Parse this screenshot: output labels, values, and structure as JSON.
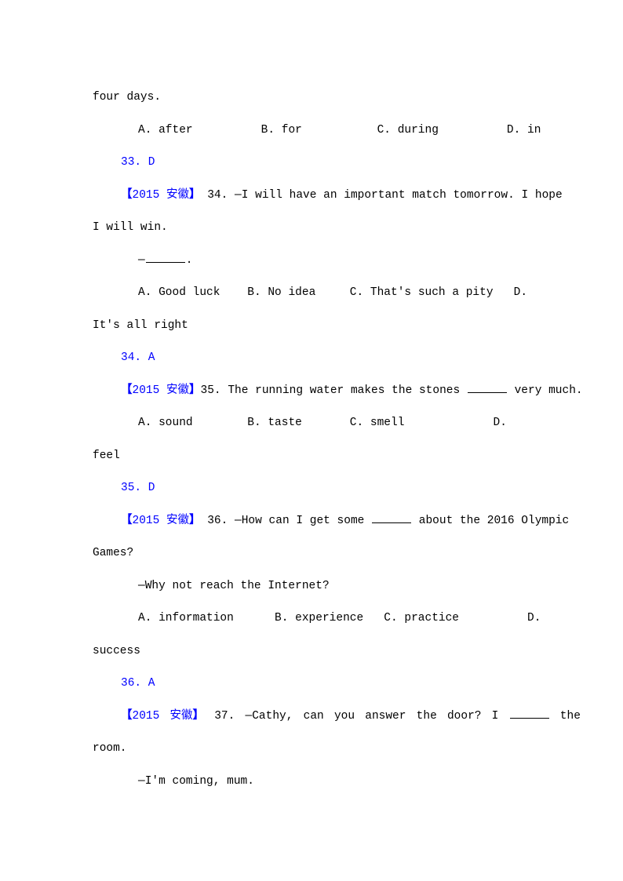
{
  "document": {
    "type": "exam-worksheet",
    "language": "en-zh",
    "colors": {
      "text": "#000000",
      "answer": "#0000ff",
      "source_tag": "#0000ff",
      "background": "#ffffff"
    },
    "source_tag_label": "【2015 安徽】",
    "blank_marker": "______",
    "dash_marker": "—"
  },
  "lines": [
    {
      "id": "q33-stem-cont",
      "kind": "stem-continuation",
      "indent": 0,
      "text": "four days."
    },
    {
      "id": "q33-options",
      "kind": "options",
      "indent": 2,
      "options": [
        {
          "letter": "A.",
          "text": "after"
        },
        {
          "letter": "B.",
          "text": "for"
        },
        {
          "letter": "C.",
          "text": "during"
        },
        {
          "letter": "D.",
          "text": "in"
        }
      ],
      "text": "A. after          B. for           C. during          D. in"
    },
    {
      "id": "q33-answer",
      "kind": "answer",
      "indent": 1,
      "number": "33.",
      "answer": "D",
      "text": "33. D"
    },
    {
      "id": "q34-stem",
      "kind": "stem",
      "indent": 1,
      "tag": "【2015 安徽】",
      "number": "34.",
      "text": "—I will have an important match tomorrow. I hope"
    },
    {
      "id": "q34-stem-cont",
      "kind": "stem-continuation",
      "indent": 0,
      "text": "I will win."
    },
    {
      "id": "q34-reply",
      "kind": "reply",
      "indent": 2,
      "text": "—______."
    },
    {
      "id": "q34-options",
      "kind": "options",
      "indent": 2,
      "options": [
        {
          "letter": "A.",
          "text": "Good luck"
        },
        {
          "letter": "B.",
          "text": "No idea"
        },
        {
          "letter": "C.",
          "text": "That's such a pity"
        },
        {
          "letter": "D.",
          "text": "It's all right"
        }
      ],
      "text": "A. Good luck    B. No idea     C. That's such a pity   D."
    },
    {
      "id": "q34-options-cont",
      "kind": "options-continuation",
      "indent": 0,
      "text": "It's all right"
    },
    {
      "id": "q34-answer",
      "kind": "answer",
      "indent": 1,
      "number": "34.",
      "answer": "A",
      "text": "34. A"
    },
    {
      "id": "q35-stem",
      "kind": "stem",
      "indent": 1,
      "tag": "【2015 安徽】",
      "number": "35.",
      "text": "The running water makes the stones ______ very much."
    },
    {
      "id": "q35-options",
      "kind": "options",
      "indent": 2,
      "options": [
        {
          "letter": "A.",
          "text": "sound"
        },
        {
          "letter": "B.",
          "text": "taste"
        },
        {
          "letter": "C.",
          "text": "smell"
        },
        {
          "letter": "D.",
          "text": "feel"
        }
      ],
      "text": "A. sound        B. taste       C. smell             D."
    },
    {
      "id": "q35-options-cont",
      "kind": "options-continuation",
      "indent": 0,
      "text": "feel"
    },
    {
      "id": "q35-answer",
      "kind": "answer",
      "indent": 1,
      "number": "35.",
      "answer": "D",
      "text": "35. D"
    },
    {
      "id": "q36-stem",
      "kind": "stem",
      "indent": 1,
      "tag": "【2015 安徽】",
      "number": "36.",
      "text": "—How can I get some ______ about the 2016 Olympic"
    },
    {
      "id": "q36-stem-cont",
      "kind": "stem-continuation",
      "indent": 0,
      "text": "Games?"
    },
    {
      "id": "q36-reply",
      "kind": "reply",
      "indent": 2,
      "text": "—Why not reach the Internet?"
    },
    {
      "id": "q36-options",
      "kind": "options",
      "indent": 2,
      "options": [
        {
          "letter": "A.",
          "text": "information"
        },
        {
          "letter": "B.",
          "text": "experience"
        },
        {
          "letter": "C.",
          "text": "practice"
        },
        {
          "letter": "D.",
          "text": "success"
        }
      ],
      "text": "A. information      B. experience   C. practice          D."
    },
    {
      "id": "q36-options-cont",
      "kind": "options-continuation",
      "indent": 0,
      "text": "success"
    },
    {
      "id": "q36-answer",
      "kind": "answer",
      "indent": 1,
      "number": "36.",
      "answer": "A",
      "text": "36. A"
    },
    {
      "id": "q37-stem",
      "kind": "stem",
      "indent": 1,
      "tag": "【2015 安徽】",
      "number": "37.",
      "text": "—Cathy, can you answer the door? I ______ the"
    },
    {
      "id": "q37-stem-cont",
      "kind": "stem-continuation",
      "indent": 0,
      "text": "room."
    },
    {
      "id": "q37-reply",
      "kind": "reply",
      "indent": 2,
      "text": "—I'm coming, mum."
    }
  ],
  "text": {
    "l01": "four days.",
    "l02_a_letter": "A.",
    "l02_a_text": "after",
    "l02_b_letter": "B.",
    "l02_b_text": "for",
    "l02_c_letter": "C.",
    "l02_c_text": "during",
    "l02_d_letter": "D.",
    "l02_d_text": "in",
    "l03": "33. D",
    "l04_tag_open": "【",
    "l04_tag_body": "2015 安徽",
    "l04_tag_close": "】",
    "l04_num": "34.",
    "l04_body": "—I will have an important match tomorrow. I hope",
    "l05": "I will win.",
    "l06_dash": "—",
    "l06_period": ".",
    "l07_a_letter": "A.",
    "l07_a_text": "Good luck",
    "l07_b_letter": "B.",
    "l07_b_text": "No idea",
    "l07_c_letter": "C.",
    "l07_c_text": "That's such a pity",
    "l07_d_letter": "D.",
    "l08": "It's all right",
    "l09": "34. A",
    "l10_num": "35.",
    "l10_before": "The running water makes the stones",
    "l10_after": "very much.",
    "l11_a_letter": "A.",
    "l11_a_text": "sound",
    "l11_b_letter": "B.",
    "l11_b_text": "taste",
    "l11_c_letter": "C.",
    "l11_c_text": "smell",
    "l11_d_letter": "D.",
    "l12": "feel",
    "l13": "35. D",
    "l14_num": "36.",
    "l14_before": "—How can I get some",
    "l14_after": "about the 2016 Olympic",
    "l15": "Games?",
    "l16": "—Why not reach the Internet?",
    "l17_a_letter": "A.",
    "l17_a_text": "information",
    "l17_b_letter": "B.",
    "l17_b_text": "experience",
    "l17_c_letter": "C.",
    "l17_c_text": "practice",
    "l17_d_letter": "D.",
    "l18": "success",
    "l19": "36. A",
    "l20_num": "37.",
    "l20_before": "—Cathy, can you answer the door? I",
    "l20_after": "the",
    "l21": "room.",
    "l22": "—I'm coming, mum."
  }
}
